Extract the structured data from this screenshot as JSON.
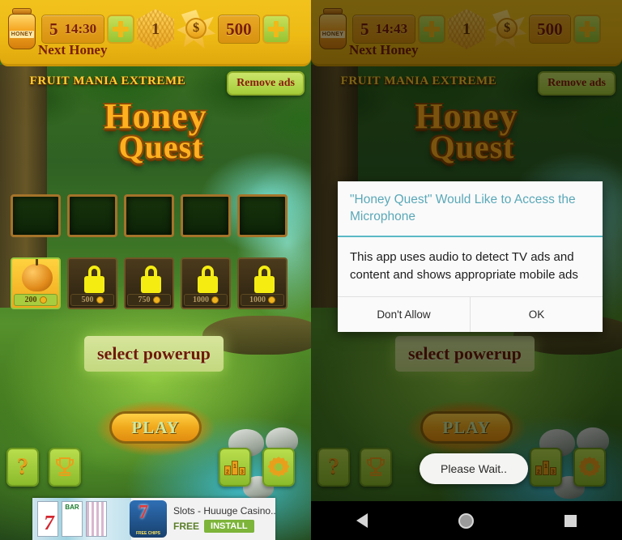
{
  "hud": {
    "honey_icon": "honey-jar-icon",
    "honey_label": "HONEY",
    "lives_count": "5",
    "timer_left": "14:30",
    "timer_right": "14:43",
    "next_honey_label": "Next Honey",
    "add_lives_label": "+",
    "hex_currency": "1",
    "star_currency_symbol": "$",
    "coins": "500",
    "add_coins_label": "+"
  },
  "header": {
    "cross_promo": "FRUIT MANIA EXTREME",
    "remove_ads": "Remove ads",
    "logo_line1": "Honey",
    "logo_line2": "Quest"
  },
  "powerups": {
    "slots": [
      "",
      "",
      "",
      "",
      ""
    ],
    "items": [
      {
        "price": "200",
        "locked": false,
        "icon": "pumpkin-icon"
      },
      {
        "price": "500",
        "locked": true,
        "icon": "lock-icon"
      },
      {
        "price": "750",
        "locked": true,
        "icon": "lock-icon"
      },
      {
        "price": "1000",
        "locked": true,
        "icon": "lock-icon"
      },
      {
        "price": "1000",
        "locked": true,
        "icon": "lock-icon"
      }
    ],
    "select_label": "select powerup"
  },
  "main": {
    "play_label": "PLAY"
  },
  "bottom_nav": [
    {
      "name": "help",
      "glyph": "?"
    },
    {
      "name": "trophy",
      "glyph": " "
    },
    {
      "name": "leaderboard",
      "glyph": ""
    },
    {
      "name": "settings",
      "glyph": ""
    }
  ],
  "podium": {
    "first": "1",
    "second": "2",
    "third": "3"
  },
  "ad": {
    "title": "Slots - Huuuge Casino...",
    "free_label": "FREE",
    "install_label": "INSTALL",
    "art_reel1": "BAR",
    "art_reel2": "BAR",
    "thumb_chips": "FREE CHIPS"
  },
  "dialog": {
    "title": "\"Honey Quest\" Would Like to Access the Microphone",
    "message": "This app uses audio to detect TV ads and content and shows appropriate mobile ads",
    "deny_label": "Don't Allow",
    "allow_label": "OK"
  },
  "toast": {
    "text": "Please Wait.."
  },
  "android_nav": {
    "back": "back-icon",
    "home": "home-icon",
    "recents": "recents-icon"
  },
  "colors": {
    "hud_gold": "#eebb15",
    "accent_green": "#9ac93a",
    "dialog_title": "#5aa8b8",
    "lock_yellow": "#f5ed12"
  }
}
